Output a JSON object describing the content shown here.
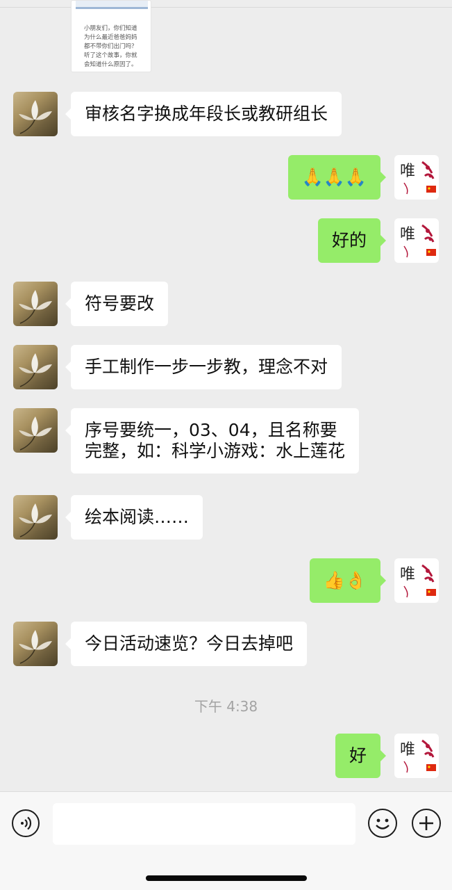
{
  "shared_card": {
    "text": "小朋友们，你们知道\n为什么最近爸爸妈妈\n都不带你们出门吗？\n听了这个故事，你就\n会知道什么原因了。"
  },
  "messages": [
    {
      "side": "left",
      "text": "审核名字换成年段长或教研组长"
    },
    {
      "side": "right",
      "text": "🙏🙏🙏"
    },
    {
      "side": "right",
      "text": "好的"
    },
    {
      "side": "left",
      "text": "符号要改"
    },
    {
      "side": "left",
      "text": "手工制作一步一步教，理念不对"
    },
    {
      "side": "left",
      "text": "序号要统一，03、04，且名称要\n完整，如：科学小游戏：水上莲花"
    },
    {
      "side": "left",
      "text": "绘本阅读……"
    },
    {
      "side": "right",
      "text": "👍👌"
    },
    {
      "side": "left",
      "text": "今日活动速览？今日去掉吧"
    },
    {
      "side": "right",
      "text": "好"
    }
  ],
  "timestamp": "下午 4:38",
  "input_bar": {
    "voice_icon": "voice-icon",
    "emoji_icon": "emoji-icon",
    "plus_icon": "plus-icon",
    "input_value": ""
  },
  "colors": {
    "background": "#ededed",
    "sent_bubble": "#95ec69",
    "received_bubble": "#ffffff"
  }
}
